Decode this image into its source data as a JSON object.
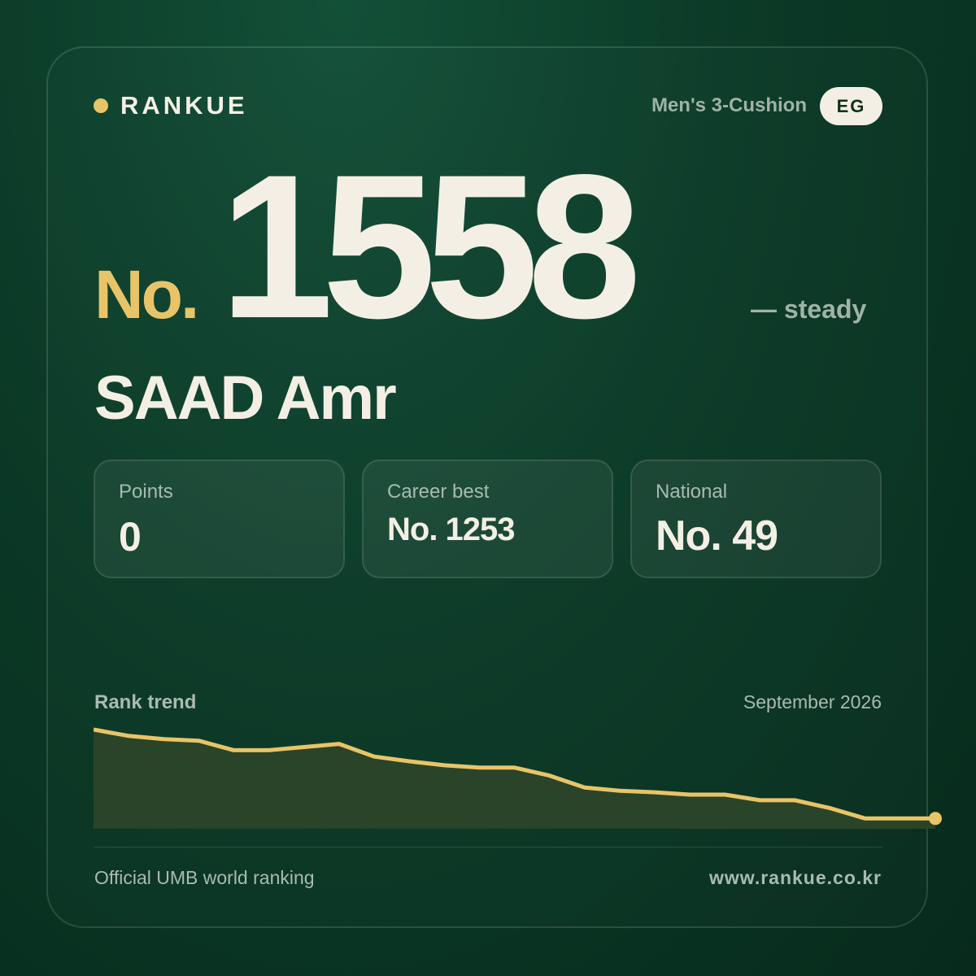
{
  "brand": {
    "name": "RANKUE"
  },
  "header": {
    "category": "Men's 3-Cushion",
    "country_code": "EG"
  },
  "rank": {
    "prefix": "No.",
    "number": "1558",
    "trend": "— steady"
  },
  "player": {
    "name": "SAAD Amr"
  },
  "stats": [
    {
      "label": "Points",
      "value": "0"
    },
    {
      "label": "Career best",
      "value": "No. 1253"
    },
    {
      "label": "National",
      "value": "No. 49"
    }
  ],
  "chart": {
    "title": "Rank trend",
    "date": "September 2026"
  },
  "footer": {
    "left": "Official UMB world ranking",
    "right": "www.rankue.co.kr"
  },
  "colors": {
    "accent": "#e8c468",
    "text": "#f4efe4",
    "muted": "#a9bbb0",
    "area_fill": "#2a4429"
  },
  "chart_data": {
    "type": "area",
    "title": "Rank trend",
    "x_label": "September 2026",
    "values": [
      0,
      8,
      12,
      14,
      26,
      26,
      22,
      18,
      34,
      40,
      45,
      48,
      48,
      58,
      73,
      77,
      79,
      82,
      82,
      89,
      89,
      99,
      112,
      112,
      112
    ],
    "ylim": [
      0,
      125
    ]
  }
}
